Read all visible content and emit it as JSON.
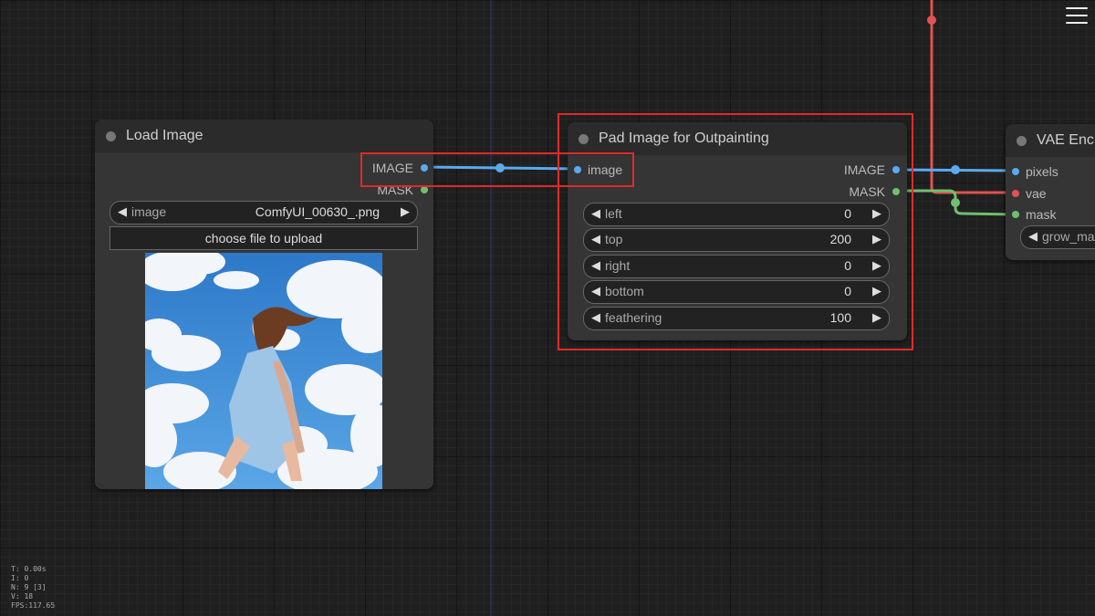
{
  "canvas": {
    "stats": [
      "T: 0.00s",
      "I: 0",
      "N: 9 [3]",
      "V: 18",
      "FPS:117.65"
    ]
  },
  "colors": {
    "image_link": "#5aaaf0",
    "mask_link": "#6fbf6f",
    "vae_link": "#e05252",
    "highlight": "#e02a2a"
  },
  "nodes": {
    "load_image": {
      "title": "Load Image",
      "outputs": [
        "IMAGE",
        "MASK"
      ],
      "widget": {
        "label": "image",
        "value": "ComfyUI_00630_.png"
      },
      "upload_label": "choose file to upload",
      "preview_icon": "image-preview"
    },
    "pad_image": {
      "title": "Pad Image for Outpainting",
      "input": "image",
      "outputs": [
        "IMAGE",
        "MASK"
      ],
      "widgets": [
        {
          "label": "left",
          "value": "0"
        },
        {
          "label": "top",
          "value": "200"
        },
        {
          "label": "right",
          "value": "0"
        },
        {
          "label": "bottom",
          "value": "0"
        },
        {
          "label": "feathering",
          "value": "100"
        }
      ]
    },
    "vae_encode": {
      "title": "VAE Enc",
      "inputs": [
        "pixels",
        "vae",
        "mask"
      ],
      "widget_label": "grow_ma"
    }
  },
  "menu_icon": "hamburger-menu-icon"
}
